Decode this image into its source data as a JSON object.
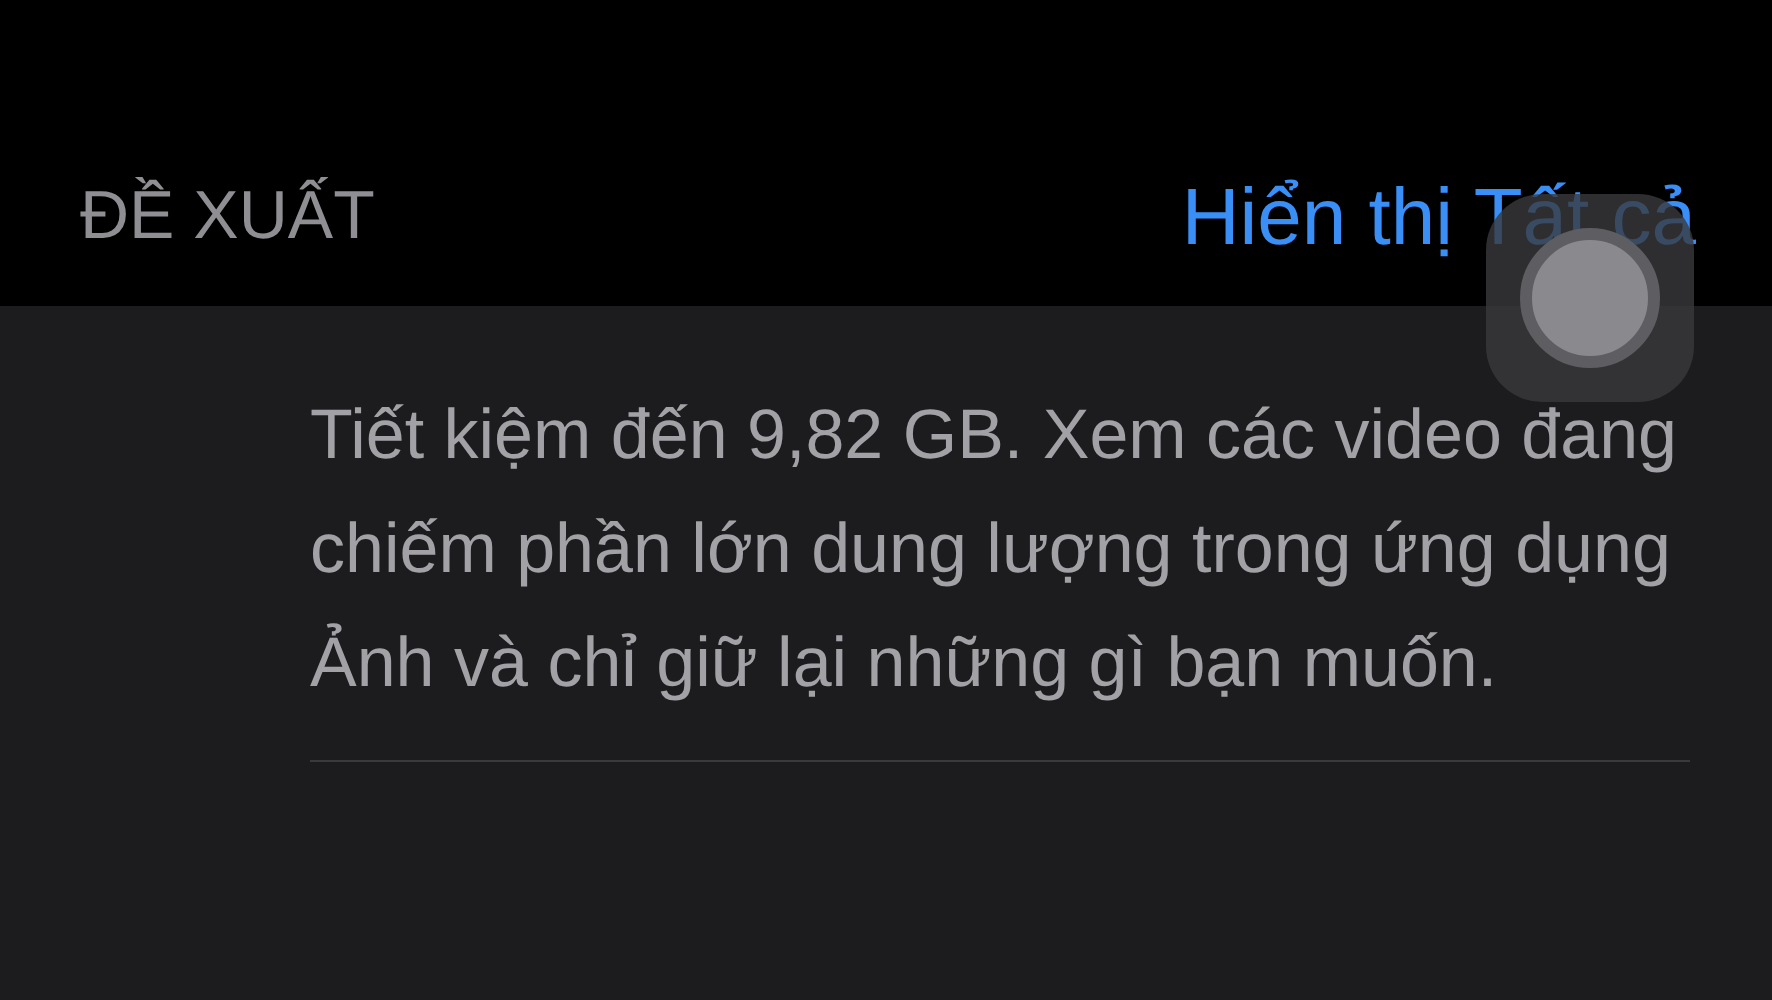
{
  "section": {
    "header": "ĐỀ XUẤT",
    "action": "Hiển thị Tất cả"
  },
  "recommendation": {
    "description": "Tiết kiệm đến 9,82 GB. Xem các video đang chiếm phần lớn dung lượng trong ứng dụng Ảnh và chỉ giữ lại những gì bạn muốn."
  }
}
